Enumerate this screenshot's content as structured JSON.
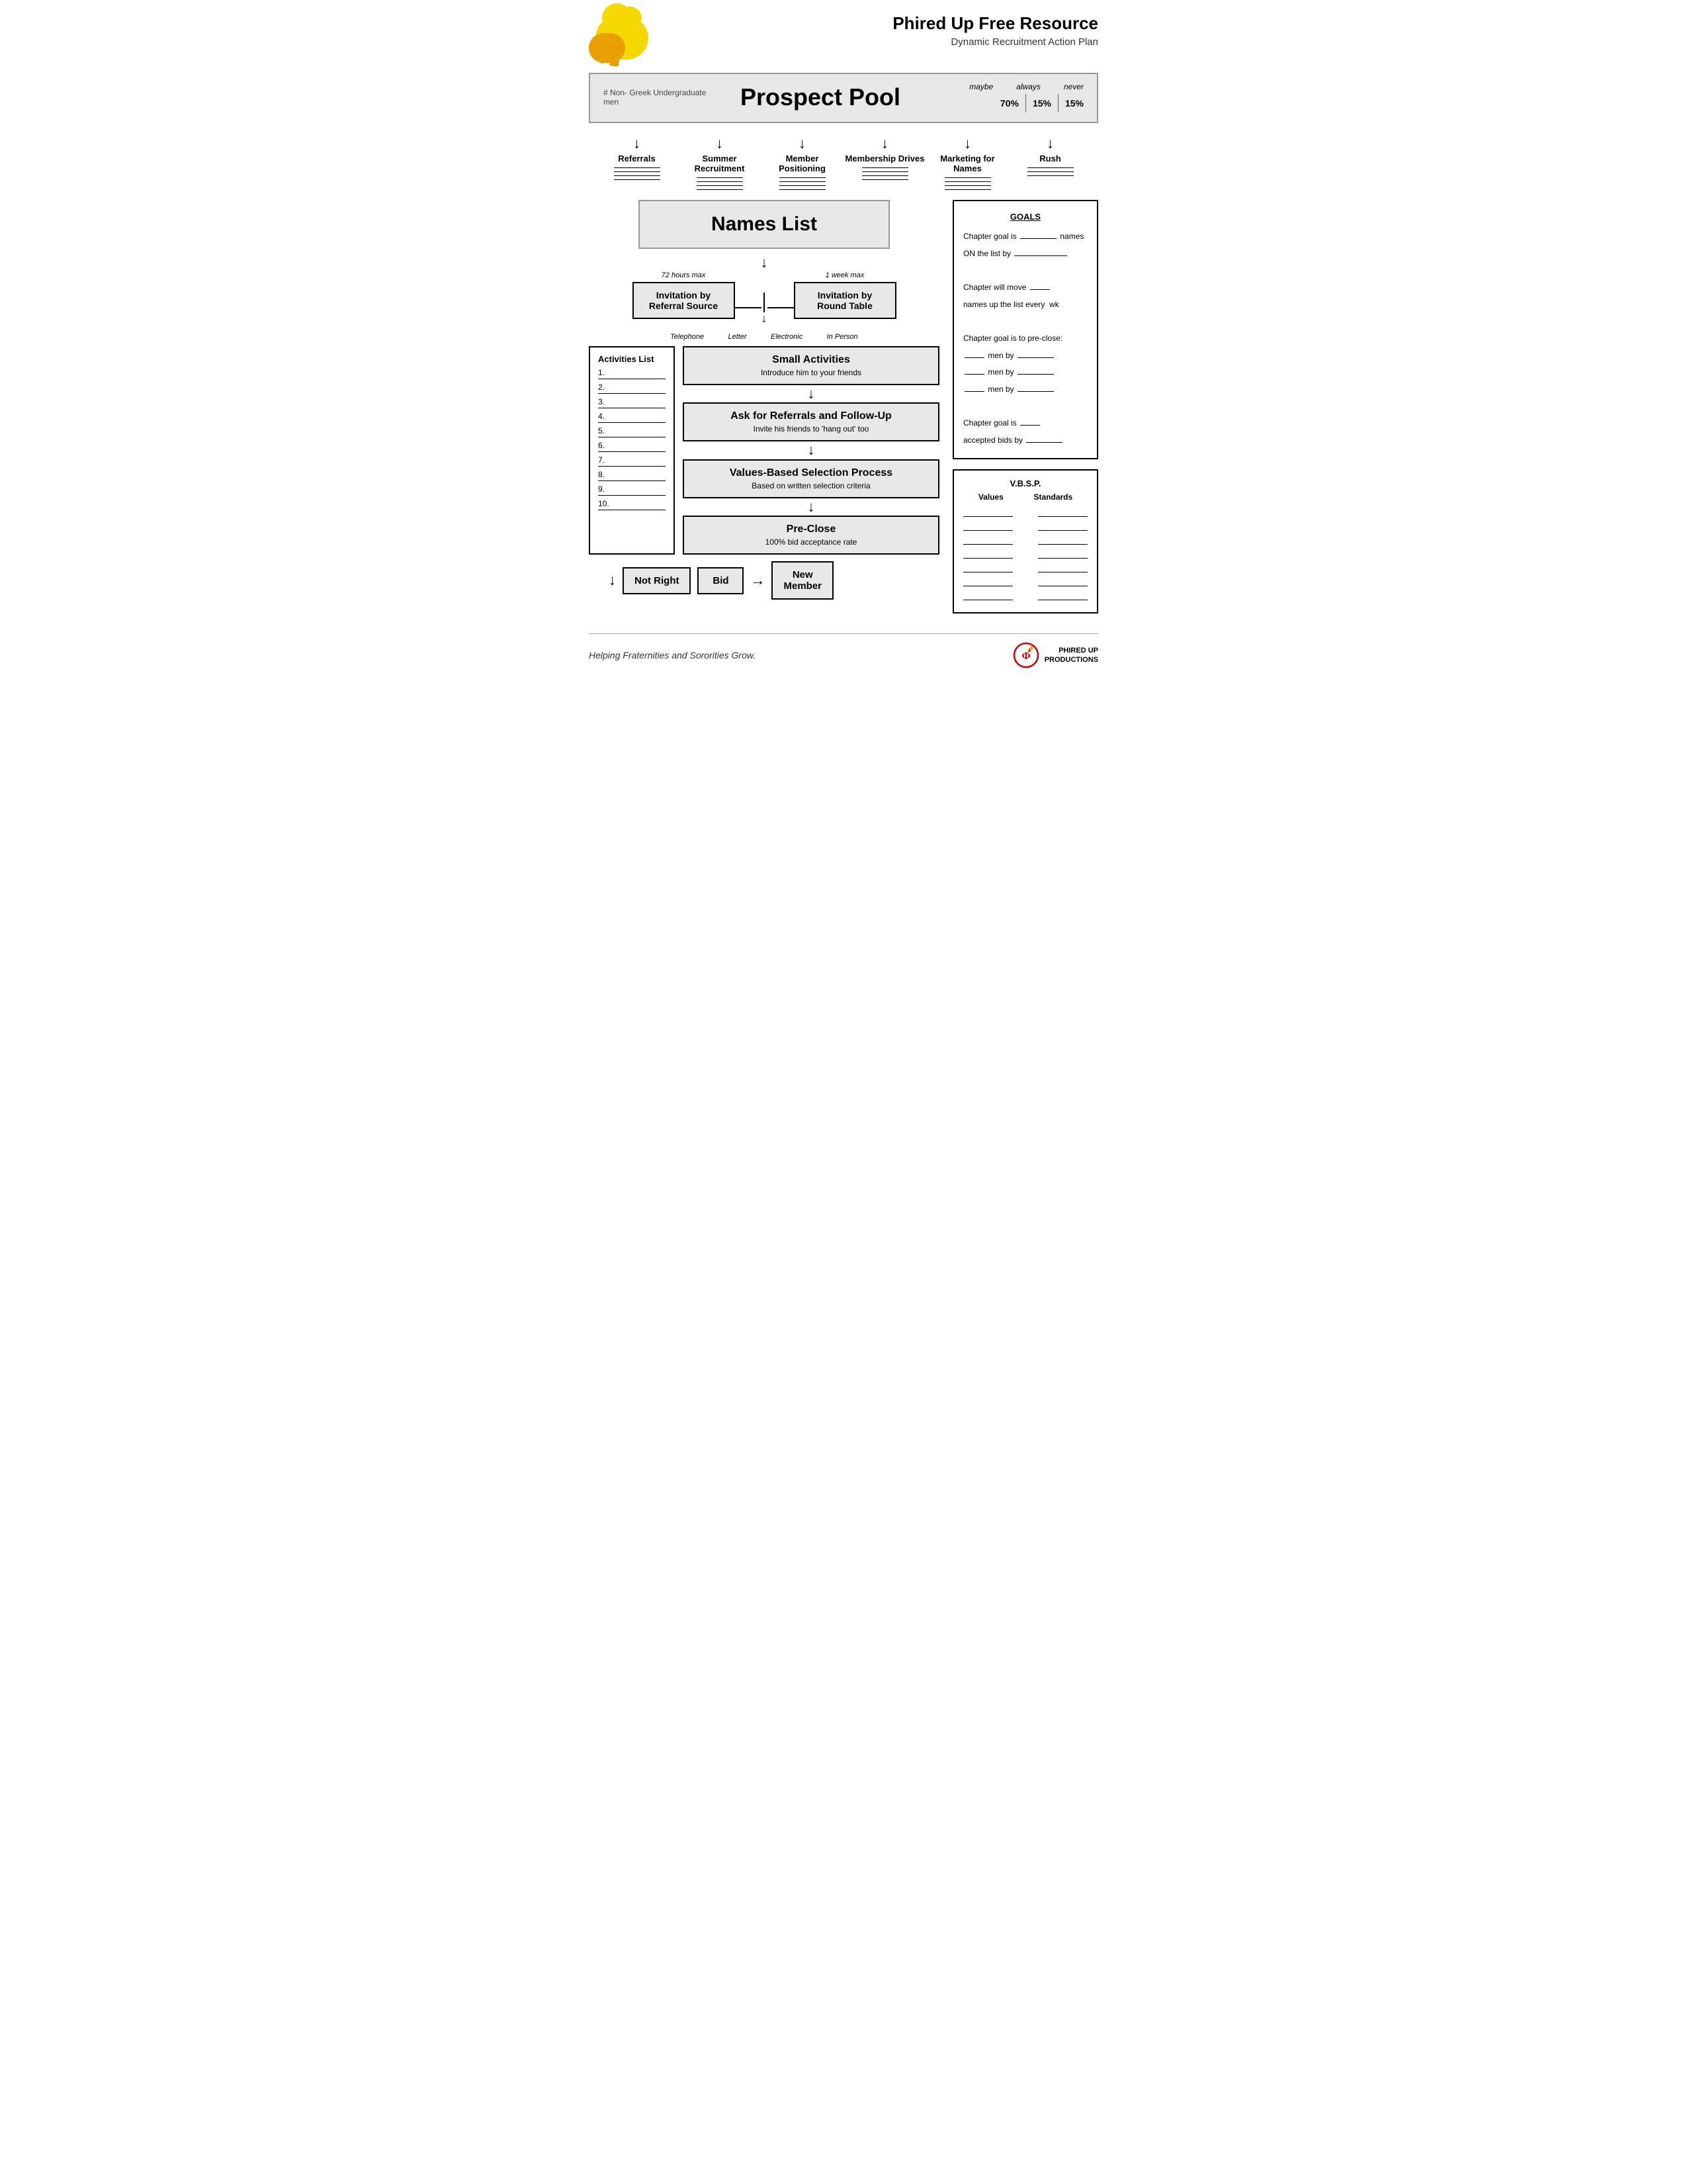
{
  "header": {
    "main_title": "Phired Up Free Resource",
    "sub_title": "Dynamic Recruitment Action Plan"
  },
  "prospect_pool": {
    "left_label": "# Non- Greek Undergraduate men",
    "title": "Prospect Pool",
    "maybe_label": "maybe",
    "always_label": "always",
    "never_label": "never",
    "maybe_pct": "70%",
    "always_pct": "15%",
    "never_pct": "15%"
  },
  "arrows": [
    {
      "label": "Referrals"
    },
    {
      "label": "Summer Recruitment"
    },
    {
      "label": "Member Positioning"
    },
    {
      "label": "Membership Drives"
    },
    {
      "label": "Marketing for Names"
    },
    {
      "label": "Rush"
    }
  ],
  "names_list": {
    "title": "Names List"
  },
  "invitation": {
    "left_timing": "72 hours max",
    "right_timing": "1 week max",
    "left_box_line1": "Invitation by",
    "left_box_line2": "Referral Source",
    "right_box_line1": "Invitation by",
    "right_box_line2": "Round Table",
    "sub_labels": [
      "Telephone",
      "Letter",
      "Electronic",
      "In Person"
    ]
  },
  "activities_list": {
    "title": "Activities List",
    "items": [
      "1.",
      "2.",
      "3.",
      "4.",
      "5.",
      "6.",
      "7.",
      "8.",
      "9.",
      "10."
    ]
  },
  "flow_boxes": [
    {
      "title": "Small Activities",
      "sub": "Introduce him to your friends"
    },
    {
      "title": "Ask for Referrals and Follow-Up",
      "sub": "Invite his friends to 'hang out' too"
    },
    {
      "title": "Values-Based Selection Process",
      "sub": "Based on written selection criteria"
    },
    {
      "title": "Pre-Close",
      "sub": "100% bid acceptance rate"
    }
  ],
  "bottom_buttons": {
    "not_right": "Not Right",
    "bid": "Bid",
    "new_member_line1": "New",
    "new_member_line2": "Member"
  },
  "goals": {
    "title": "GOALS",
    "lines": [
      "Chapter goal is ______ names",
      "ON the list by _______________",
      "",
      "Chapter will move ______",
      "names up the list every  wk",
      "",
      "Chapter goal is to pre-close:",
      "______ men by ___________",
      "______ men by ___________",
      "______ men by ___________",
      "",
      "Chapter goal is ______",
      "accepted bids by _________"
    ]
  },
  "vbsp": {
    "title": "V.B.S.P.",
    "col1": "Values",
    "col2": "Standards",
    "rows": 7
  },
  "footer": {
    "tagline": "Helping Fraternities and Sororities Grow.",
    "logo_line1": "PHIRED UP",
    "logo_line2": "PRODUCTIONS"
  }
}
